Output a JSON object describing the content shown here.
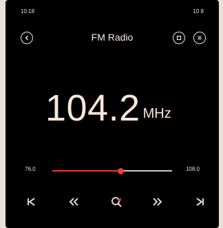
{
  "status": {
    "time": "10:18",
    "right_text": "10 8"
  },
  "header": {
    "title": "FM Radio",
    "icons": [
      "back-icon",
      "record-icon",
      "menu-icon"
    ]
  },
  "tuner": {
    "frequency": "104.2",
    "unit": "MHz"
  },
  "slider": {
    "min_label": "76.0",
    "max_label": "108.0",
    "value_fraction": 0.57
  },
  "controls": {
    "icons": [
      "skip-previous-icon",
      "seek-back-icon",
      "search-icon",
      "seek-forward-icon",
      "skip-next-icon"
    ]
  },
  "colors": {
    "accent": "#e83a36",
    "frequency_text": "#fde7d6",
    "background": "#000000"
  }
}
